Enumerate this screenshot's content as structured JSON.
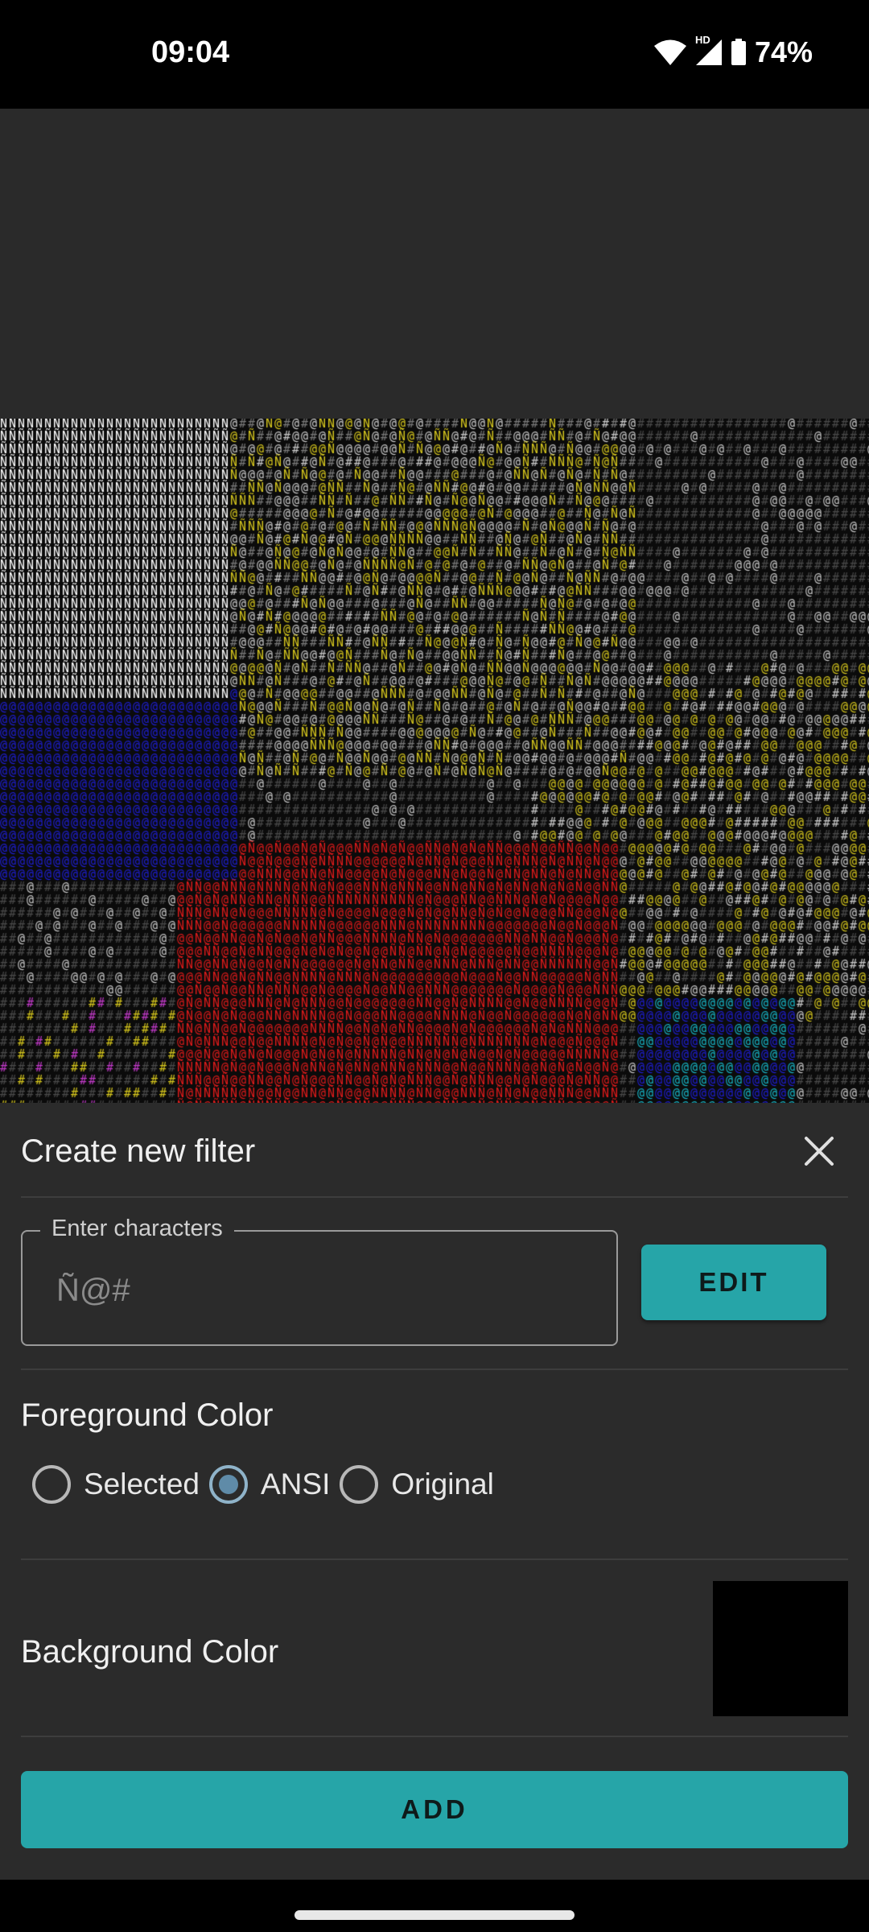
{
  "status": {
    "time": "09:04",
    "hd_label": "HD",
    "battery": "74%"
  },
  "sheet": {
    "title": "Create new filter",
    "char_field_label": "Enter characters",
    "char_field_placeholder": "Ñ@#",
    "edit_label": "EDIT",
    "fg_title": "Foreground Color",
    "fg_options": [
      "Selected",
      "ANSI",
      "Original"
    ],
    "fg_selected": "ANSI",
    "bg_title": "Background Color",
    "bg_color": "#000000",
    "add_label": "ADD"
  },
  "preview": {
    "charset": "Ñ@#",
    "palette": [
      "#ffffff",
      "#c8c8c8",
      "#7a7a7a",
      "#4a4a4a",
      "#d4c51e",
      "#1f1fd9",
      "#e01b1b",
      "#17b5c6",
      "#c23bc9"
    ]
  },
  "colors": {
    "accent": "#26a5a8",
    "sheet_bg": "#2b2b2b",
    "radio_on": "#5f8ba8"
  }
}
